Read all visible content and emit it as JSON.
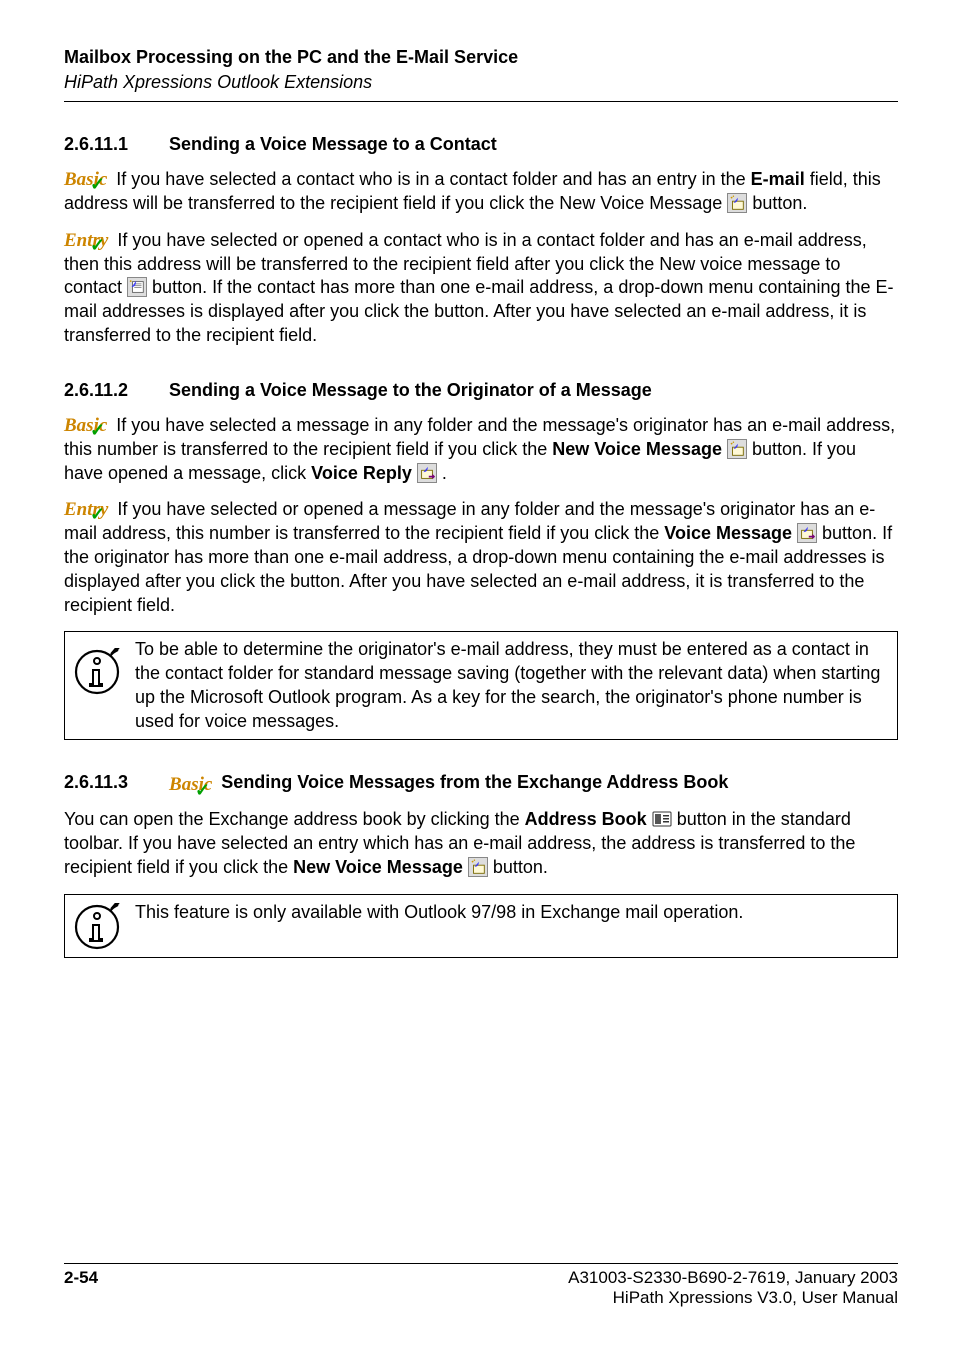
{
  "header": {
    "title": "Mailbox Processing on the PC and the E-Mail Service",
    "subtitle": "HiPath Xpressions Outlook Extensions"
  },
  "labels": {
    "basic": "Basic",
    "entry": "Entry"
  },
  "sections": {
    "s1": {
      "num": "2.6.11.1",
      "title": "Sending a Voice Message to a Contact",
      "p1a": " If you have selected a contact who is in a contact folder and has an entry in the ",
      "p1b": "E-mail",
      "p1c": " field, this address will be transferred to the recipient field if you click the New Voice Message ",
      "p1d": " button.",
      "p2a": " If you have selected or opened a contact who is in a contact folder and has an e-mail address, then this address will be transferred to the recipient field after you click the New voice message to contact ",
      "p2b": " button. If the contact has more than one e-mail address, a drop-down menu containing the E-mail addresses is displayed after you click the button. After you have selected an e-mail address, it is transferred to the recipient field."
    },
    "s2": {
      "num": "2.6.11.2",
      "title": "Sending a Voice Message to the Originator of a Message",
      "p1a": " If you have selected a message in any folder and the message's originator has an e-mail address, this number is transferred to the recipient field if you click the ",
      "p1b": "New Voice Message",
      "p1c": " ",
      "p1d": " button. If you have opened a message, click ",
      "p1e": "Voice Reply",
      "p1f": " ",
      "p1g": " .",
      "p2a": " If you have selected or opened a message in any folder and the message's originator has an e-mail address, this number is transferred to the recipient field if you click the ",
      "p2b": "Voice Message",
      "p2c": " ",
      "p2d": " button. If the originator has more than one e-mail address, a drop-down menu containing the e-mail addresses is displayed after you click the button. After you have selected an e-mail address, it is transferred to the recipient field.",
      "note": "To be able to determine the originator's e-mail address, they must be entered as a contact in the contact folder for standard message saving (together with the relevant data) when starting up the Microsoft Outlook program. As a key for the search, the originator's phone number is used for voice messages."
    },
    "s3": {
      "num": "2.6.11.3",
      "title": " Sending Voice Messages from the Exchange Address Book",
      "p1a": "You can open the Exchange address book by clicking the ",
      "p1b": "Address Book",
      "p1c": " ",
      "p1d": " button in the standard toolbar. If you have selected an entry which has an e-mail address, the address is transferred to the recipient field if you click the ",
      "p1e": "New Voice Message",
      "p1f": " ",
      "p1g": " button.",
      "note": "This feature is only available with Outlook 97/98 in Exchange mail operation."
    }
  },
  "footer": {
    "doc": "A31003-S2330-B690-2-7619, January 2003",
    "product": "HiPath Xpressions V3.0, User Manual",
    "page": "2-54"
  }
}
